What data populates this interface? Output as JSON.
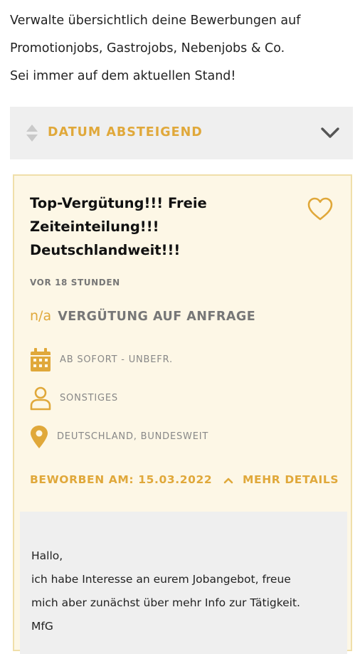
{
  "intro": {
    "lines": [
      "Verwalte übersichtlich deine Bewerbungen auf",
      "Promotionjobs, Gastrojobs, Nebenjobs & Co.",
      "Sei immer auf dem aktuellen Stand!"
    ]
  },
  "sort": {
    "label": "DATUM ABSTEIGEND",
    "icon": "sort-arrows-icon",
    "expand_icon": "chevron-down-icon"
  },
  "job": {
    "title_lines": [
      "Top-Vergütung!!! Freie",
      "Zeiteinteilung!!!",
      "Deutschlandweit!!!"
    ],
    "favorite_icon": "heart-outline-icon",
    "posted": "VOR 18 STUNDEN",
    "salary_amount": "n/a",
    "salary_desc": "VERGÜTUNG AUF ANFRAGE",
    "details": [
      {
        "icon": "calendar-icon",
        "text": "AB SOFORT - UNBEFR."
      },
      {
        "icon": "person-icon",
        "text": "SONSTIGES"
      },
      {
        "icon": "location-pin-icon",
        "text": "DEUTSCHLAND, BUNDESWEIT"
      }
    ],
    "applied_label": "BEWORBEN AM: 15.03.2022",
    "more_details_label": "MEHR DETAILS",
    "message_lines": [
      "Hallo,",
      "ich habe Interesse an eurem Jobangebot, freue",
      "mich aber zunächst über mehr Info zur Tätigkeit.",
      "MfG"
    ]
  },
  "colors": {
    "accent": "#e0a83a",
    "card_bg": "#fdf7e6",
    "card_border": "#f0dfaa",
    "panel_bg": "#efefef",
    "muted_text": "#777777"
  }
}
